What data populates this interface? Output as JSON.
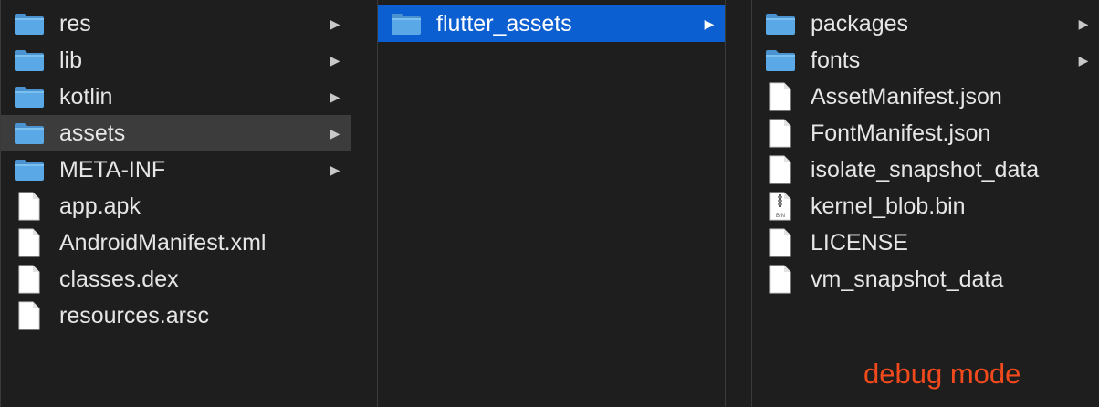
{
  "columns": [
    {
      "items": [
        {
          "label": "res",
          "kind": "folder",
          "has_children": true
        },
        {
          "label": "lib",
          "kind": "folder",
          "has_children": true
        },
        {
          "label": "kotlin",
          "kind": "folder",
          "has_children": true
        },
        {
          "label": "assets",
          "kind": "folder",
          "has_children": true,
          "selected": true
        },
        {
          "label": "META-INF",
          "kind": "folder",
          "has_children": true
        },
        {
          "label": "app.apk",
          "kind": "file"
        },
        {
          "label": "AndroidManifest.xml",
          "kind": "file"
        },
        {
          "label": "classes.dex",
          "kind": "file"
        },
        {
          "label": "resources.arsc",
          "kind": "file"
        }
      ]
    },
    {
      "items": [
        {
          "label": "flutter_assets",
          "kind": "folder",
          "has_children": true,
          "selected": true
        }
      ]
    },
    {
      "items": [
        {
          "label": "packages",
          "kind": "folder",
          "has_children": true
        },
        {
          "label": "fonts",
          "kind": "folder",
          "has_children": true
        },
        {
          "label": "AssetManifest.json",
          "kind": "file"
        },
        {
          "label": "FontManifest.json",
          "kind": "file"
        },
        {
          "label": "isolate_snapshot_data",
          "kind": "file"
        },
        {
          "label": "kernel_blob.bin",
          "kind": "bin-file",
          "icon_text": "BIN"
        },
        {
          "label": "LICENSE",
          "kind": "file"
        },
        {
          "label": "vm_snapshot_data",
          "kind": "file"
        }
      ]
    }
  ],
  "annotation": {
    "text": "debug mode",
    "color": "#f24a1c"
  },
  "colors": {
    "folder": "#5aa9e6",
    "selection_active": "#0b5fd0",
    "selection_inactive": "#3c3c3c"
  },
  "icons": {
    "folder": "folder-icon",
    "file": "file-icon",
    "bin-file": "bin-file-icon",
    "chevron": "chevron-right-icon"
  }
}
